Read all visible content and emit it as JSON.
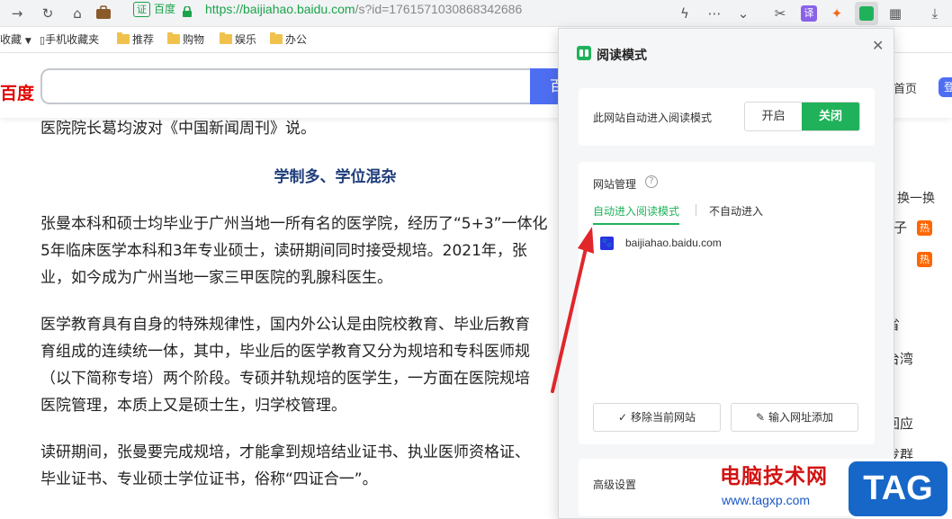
{
  "browser": {
    "cert_badge": "证",
    "site_name": "百度",
    "url_domain": "https://baijiahao.baidu.com",
    "url_rest": "/s?id=1761571030868342686",
    "translate_icon_text": "译",
    "bookmarks": [
      {
        "label": "收藏"
      },
      {
        "label": "手机收藏夹"
      },
      {
        "label": "推荐"
      },
      {
        "label": "购物"
      },
      {
        "label": "娱乐"
      },
      {
        "label": "办公"
      }
    ]
  },
  "site": {
    "logo": "百度",
    "search_button": "百",
    "home_link": "首页",
    "login_button": "登"
  },
  "article": {
    "p0": "医院院长葛均波对《中国新闻周刊》说。",
    "heading": "学制多、学位混杂",
    "p1": [
      "张曼本科和硕士均毕业于广州当地一所有名的医学院，经历了“5+3”一体化",
      "5年临床医学本科和3年专业硕士，读研期间同时接受规培。2021年，张",
      "业，如今成为广州当地一家三甲医院的乳腺科医生。"
    ],
    "p2": [
      "医学教育具有自身的特殊规律性，国内外公认是由院校教育、毕业后教育",
      "育组成的连续统一体，其中，毕业后的医学教育又分为规培和专科医师规",
      "（以下简称专培）两个阶段。专硕并轨规培的医学生，一方面在医院规培",
      "医院管理，本质上又是硕士生，归学校管理。"
    ],
    "p3": [
      "读研期间，张曼要完成规培，才能拿到规培结业证书、执业医师资格证、",
      "毕业证书、专业硕士学位证书，俗称“四证合一”。"
    ]
  },
  "sidebar": {
    "refresh": "换一换",
    "items": [
      "子",
      "",
      "省",
      "台湾",
      "回应",
      "发群"
    ],
    "hot_badge": "热"
  },
  "reading_panel": {
    "title": "阅读模式",
    "auto_label": "此网站自动进入阅读模式",
    "on_label": "开启",
    "off_label": "关闭",
    "selected": "关闭",
    "management_title": "网站管理",
    "help_icon_text": "?",
    "tab_auto": "自动进入阅读模式",
    "tab_no_auto": "不自动进入",
    "sites": [
      {
        "domain": "baijiahao.baidu.com"
      }
    ],
    "remove_button": "移除当前网站",
    "add_button": "输入网址添加",
    "advanced_title": "高级设置"
  },
  "watermark": {
    "title": "电脑技术网",
    "url": "www.tagxp.com",
    "tag": "TAG"
  },
  "colors": {
    "accent_green": "#1fb25a",
    "baidu_blue": "#4e6ef2",
    "arrow_red": "#e0262b"
  }
}
